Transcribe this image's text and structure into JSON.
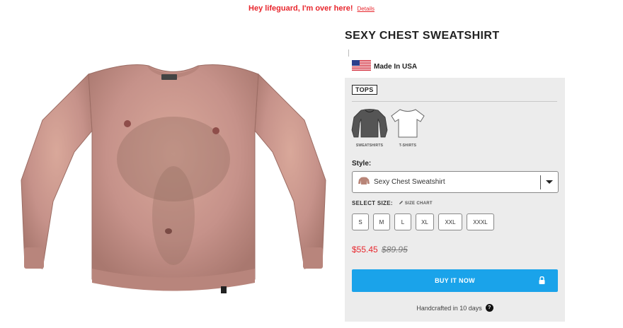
{
  "promo": {
    "message": "Hey lifeguard, I'm over here!",
    "details_link": "Details"
  },
  "product": {
    "title": "SEXY CHEST SWEATSHIRT",
    "made_in": "Made In USA",
    "category_tag": "TOPS",
    "types": [
      {
        "label": "SWEATSHIRTS"
      },
      {
        "label": "T-SHIRTS"
      }
    ],
    "style_label": "Style:",
    "style_selected": "Sexy Chest Sweatshirt",
    "size_label": "SELECT SIZE:",
    "size_chart_label": "SIZE CHART",
    "sizes": [
      "S",
      "M",
      "L",
      "XL",
      "XXL",
      "XXXL"
    ],
    "sale_price": "$55.45",
    "original_price": "$89.95",
    "buy_label": "BUY IT NOW",
    "handcrafted": "Handcrafted in 10 days",
    "help_glyph": "?"
  },
  "colors": {
    "accent": "#1aa3ea",
    "sale": "#e8262d",
    "panel": "#ececec"
  },
  "icons": [
    "us-flag-icon",
    "lock-icon",
    "chevron-down-icon",
    "pencil-icon",
    "question-icon"
  ]
}
